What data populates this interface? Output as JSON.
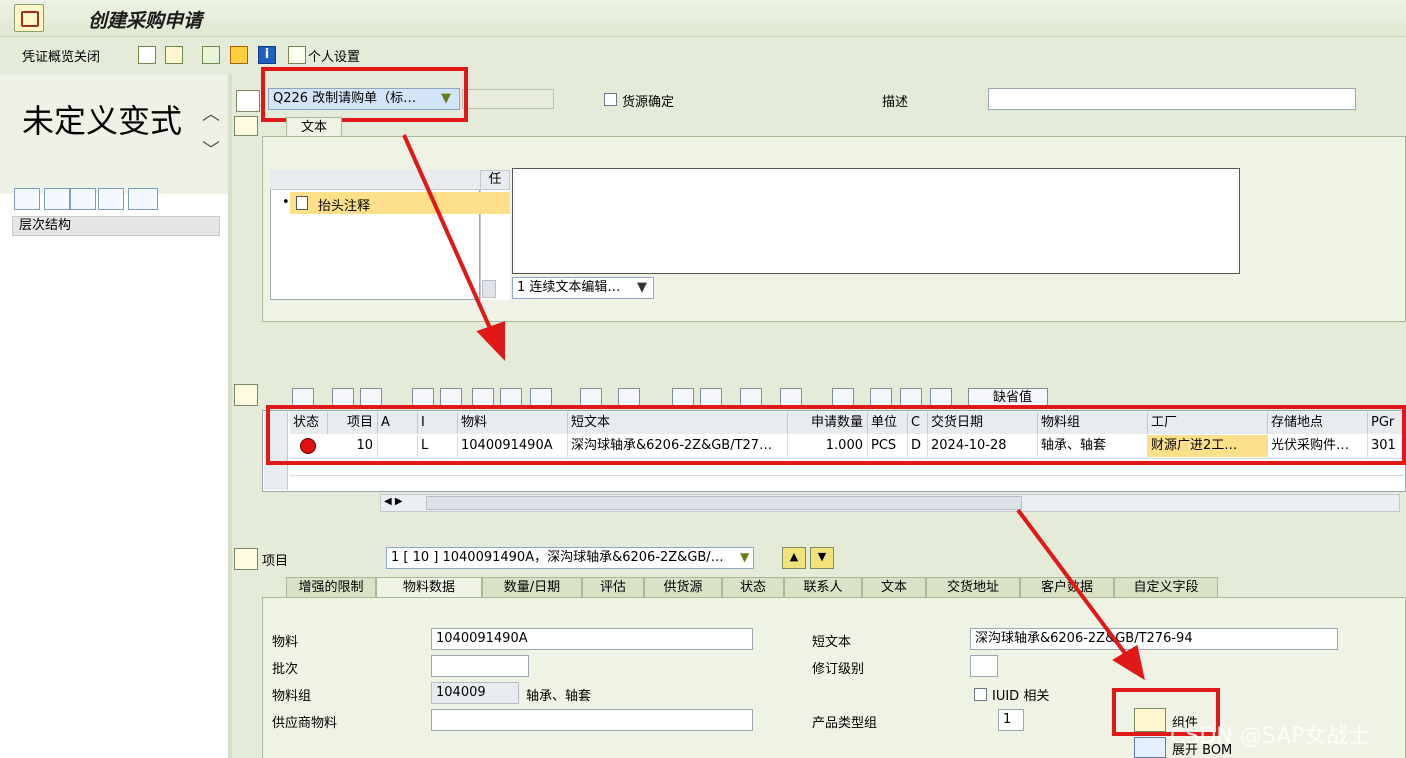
{
  "window": {
    "title": "创建采购申请"
  },
  "toolbar": {
    "close_overview": "凭证概览关闭",
    "personal_settings": "个人设置"
  },
  "left": {
    "variant_title": "未定义变式",
    "hierarchy_header": "层次结构"
  },
  "header": {
    "doc_type": "Q226 改制请购单（标…",
    "source_determination": "货源确定",
    "description_label": "描述",
    "description_value": "",
    "text_tab": "文本",
    "text_col": "任",
    "text_item": "抬头注释",
    "editor_mode": "1 连续文本编辑…"
  },
  "items": {
    "default_values_button": "缺省值",
    "columns": [
      "状态",
      "项目",
      "A",
      "I",
      "物料",
      "短文本",
      "申请数量",
      "单位",
      "C",
      "交货日期",
      "物料组",
      "工厂",
      "存储地点",
      "PGr"
    ],
    "rows": [
      {
        "status": "red",
        "item": "10",
        "a": "",
        "i": "L",
        "material": "1040091490A",
        "short_text": "深沟球轴承&6206-2Z&GB/T27…",
        "quantity": "1.000",
        "unit": "PCS",
        "c": "D",
        "delivery_date": "2024-10-28",
        "material_group": "轴承、轴套",
        "plant": "财源广进2工…",
        "storage_location": "光伏采购件…",
        "pgr": "301"
      }
    ]
  },
  "detail": {
    "item_label": "项目",
    "item_selector": "1 [ 10 ] 1040091490A，深沟球轴承&6206-2Z&GB/…",
    "tabs": [
      "增强的限制",
      "物料数据",
      "数量/日期",
      "评估",
      "供货源",
      "状态",
      "联系人",
      "文本",
      "交货地址",
      "客户数据",
      "自定义字段"
    ],
    "active_tab": "物料数据",
    "material_label": "物料",
    "material_value": "1040091490A",
    "batch_label": "批次",
    "batch_value": "",
    "matgroup_label": "物料组",
    "matgroup_code": "104009",
    "matgroup_text": "轴承、轴套",
    "supplier_material_label": "供应商物料",
    "supplier_material_value": "",
    "short_text_label": "短文本",
    "short_text_value": "深沟球轴承&6206-2Z&GB/T276-94",
    "revision_label": "修订级别",
    "revision_value": "",
    "iuid_label": "IUID 相关",
    "product_type_label": "产品类型组",
    "product_type_value": "1",
    "components_button": "组件",
    "explode_bom_button": "展开 BOM"
  },
  "watermark": "CSDN @SAP女战士",
  "colors": {
    "annotation_red": "#e01818",
    "header_bg": "#e4ecd9",
    "selection": "#ffe08a"
  }
}
